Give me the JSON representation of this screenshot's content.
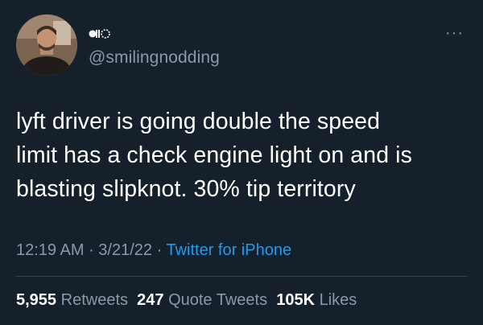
{
  "tweet": {
    "handle": "@smilingnodding",
    "more_label": "···",
    "text_lines": [
      "lyft driver is going double the speed",
      "limit has a check engine light on and is",
      "blasting slipknot. 30% tip territory"
    ],
    "time": "12:19 AM",
    "date": "3/21/22",
    "separator": " · ",
    "source": "Twitter for iPhone",
    "stats": {
      "retweets_count": "5,955",
      "retweets_label": "Retweets",
      "quote_count": "247",
      "quote_label": "Quote Tweets",
      "likes_count": "105K",
      "likes_label": "Likes"
    }
  },
  "colors": {
    "background": "#15202b",
    "text": "#ffffff",
    "muted": "#8b98a5",
    "link": "#1d9bf0",
    "divider": "#38444d"
  },
  "icons": {
    "display_name": "emoji-glyph-name-icon",
    "more": "more-options-icon"
  }
}
